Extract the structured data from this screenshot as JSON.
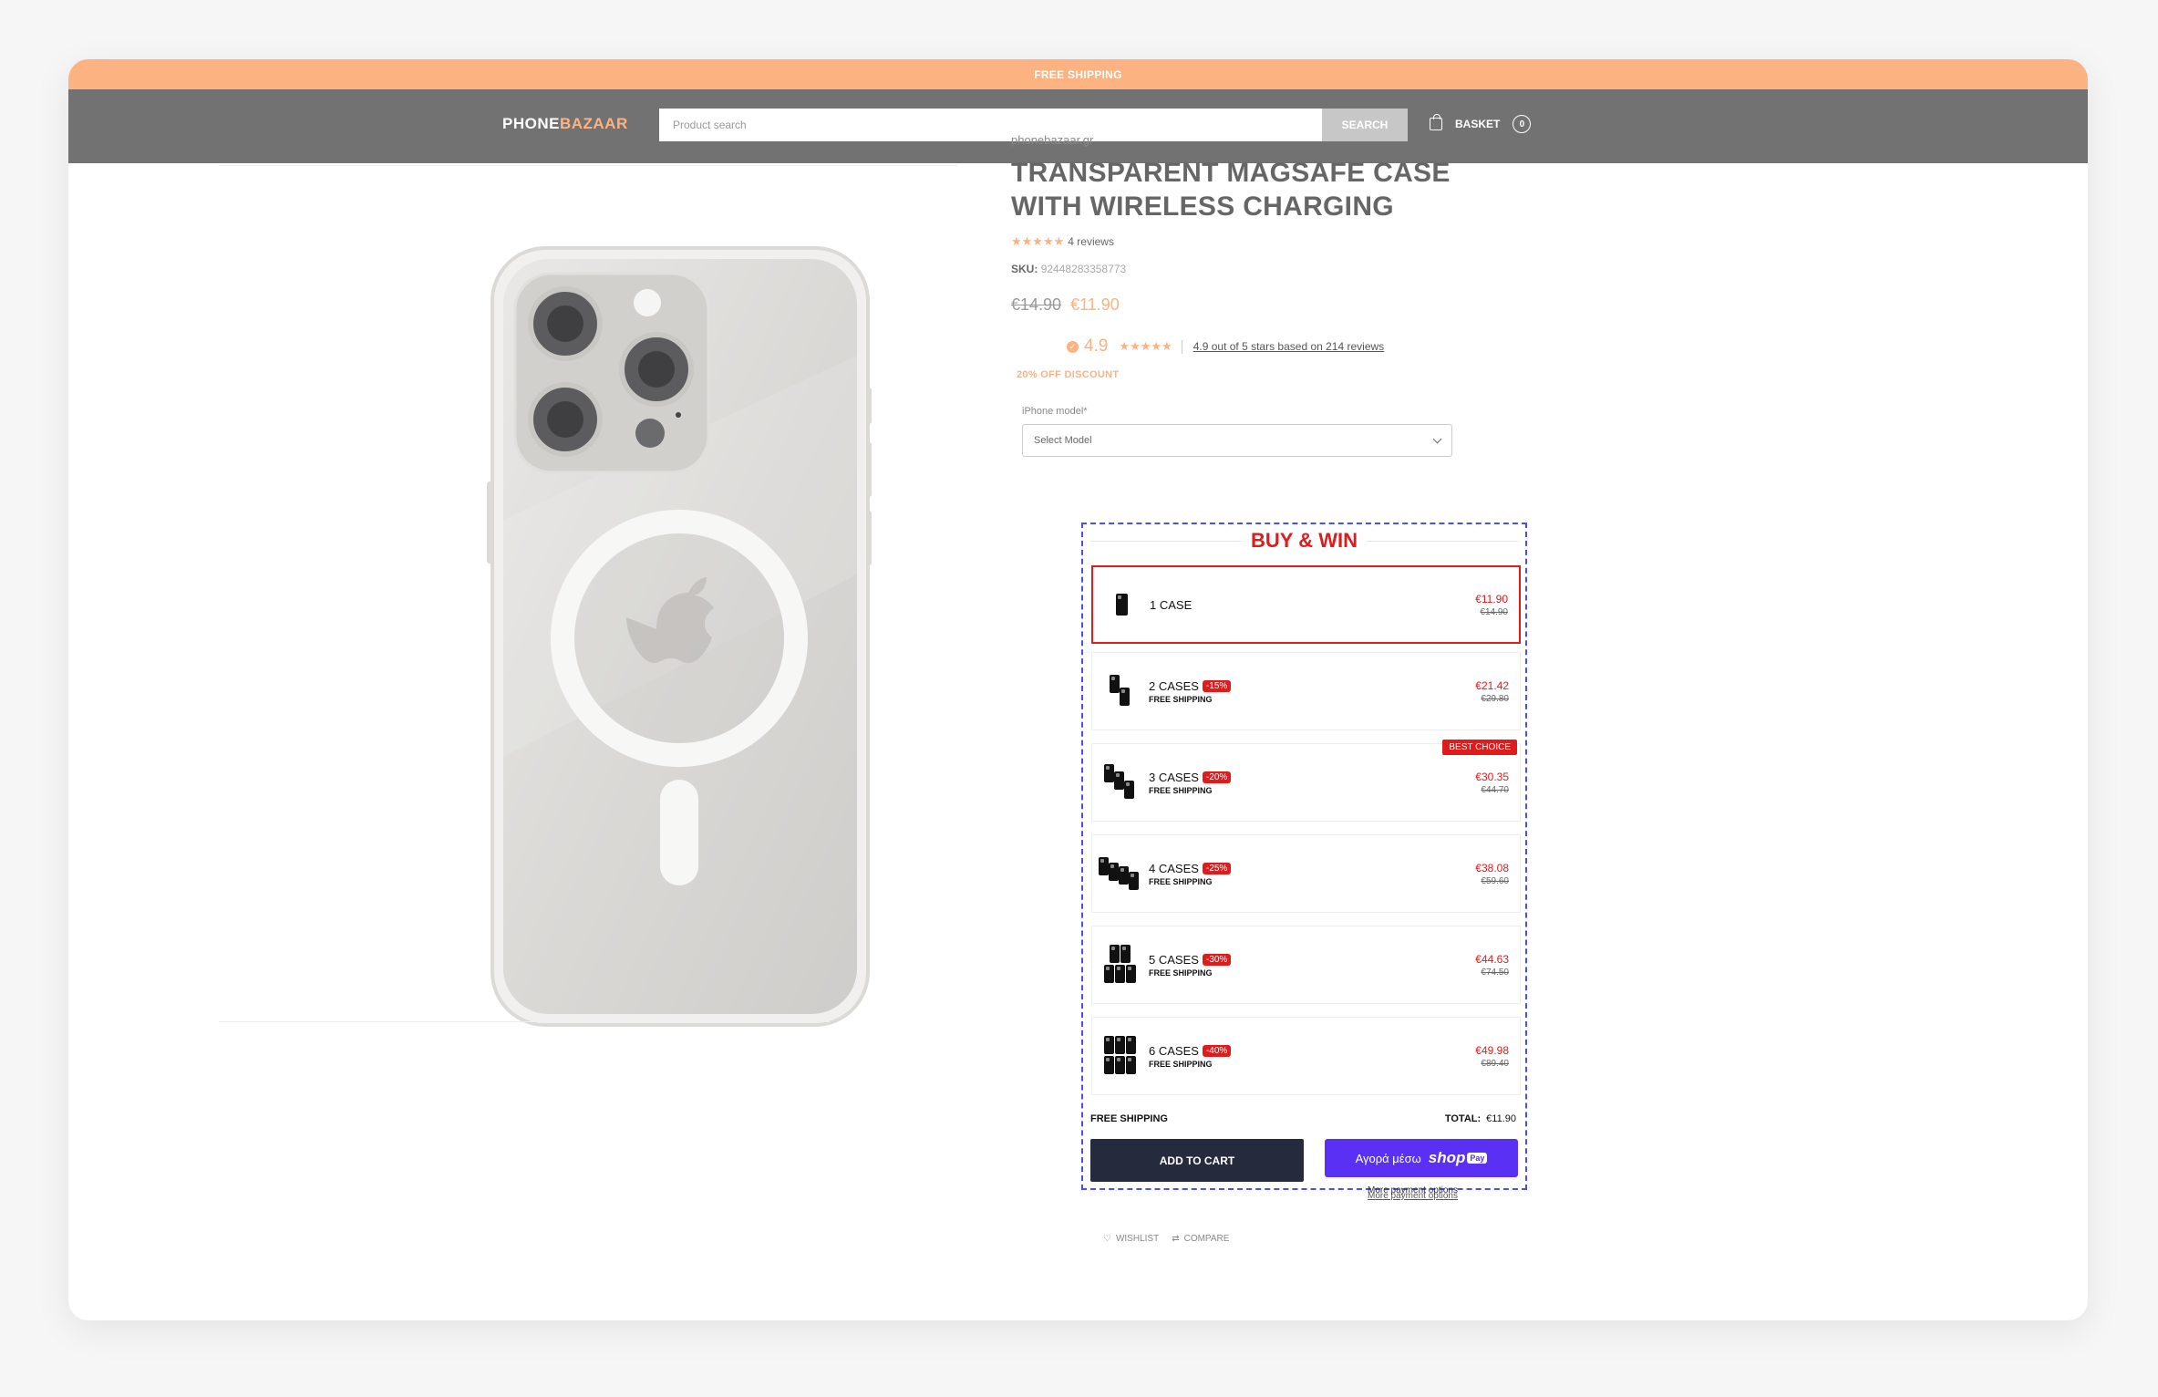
{
  "topbar": {
    "text": "FREE SHIPPING"
  },
  "header": {
    "logo_part1": "PHONE",
    "logo_part2": "BAZAAR",
    "search_placeholder": "Product search",
    "search_button": "SEARCH",
    "basket_label": "BASKET",
    "basket_count": "0"
  },
  "product": {
    "brand": "phonebazaar.gr",
    "title_line1": "TRANSPARENT MAGSAFE CASE",
    "title_line2": "WITH WIRELESS CHARGING",
    "stars": "★★★★★",
    "reviews": "4 reviews",
    "sku_label": "SKU:",
    "sku_value": "92448283358773",
    "old_price": "€14.90",
    "new_price": "€11.90",
    "rating_score": "4.9",
    "rating_text": "4.9 out of 5 stars based on 214 reviews",
    "discount": "20% OFF DISCOUNT",
    "model_label": "iPhone model*",
    "model_select": "Select Model"
  },
  "bundle": {
    "title": "BUY & WIN",
    "best_choice": "BEST CHOICE",
    "options": [
      {
        "name": "1 CASE",
        "badge": "",
        "shipping": "",
        "price": "€11.90",
        "old": "€14.90",
        "icon": "phone-case-icon"
      },
      {
        "name": "2 CASES",
        "badge": "-15%",
        "shipping": "FREE SHIPPING",
        "price": "€21.42",
        "old": "€29.80",
        "icon": "phone-case-icon"
      },
      {
        "name": "3 CASES",
        "badge": "-20%",
        "shipping": "FREE SHIPPING",
        "price": "€30.35",
        "old": "€44.70",
        "icon": "phone-case-icon"
      },
      {
        "name": "4 CASES",
        "badge": "-25%",
        "shipping": "FREE SHIPPING",
        "price": "€38.08",
        "old": "€59.60",
        "icon": "phone-case-icon"
      },
      {
        "name": "5 CASES",
        "badge": "-30%",
        "shipping": "FREE SHIPPING",
        "price": "€44.63",
        "old": "€74.50",
        "icon": "phone-case-icon"
      },
      {
        "name": "6 CASES",
        "badge": "-40%",
        "shipping": "FREE SHIPPING",
        "price": "€49.98",
        "old": "€89.40",
        "icon": "phone-case-icon"
      }
    ],
    "free_shipping": "FREE SHIPPING",
    "total_label": "TOTAL:",
    "total_value": "€11.90",
    "add_to_cart": "ADD TO CART",
    "shoppay_text": "Αγορά μέσω",
    "shoppay_brand": "shop",
    "shoppay_pay": "Pay",
    "more_options": "More payment options"
  },
  "actions": {
    "wishlist": "WISHLIST",
    "compare": "COMPARE"
  },
  "colors": {
    "accent": "#fdb282",
    "header": "#727272",
    "red": "#e01b1b",
    "dashed": "#4a4ff0",
    "shoppay": "#5a31f4",
    "cart": "#262a3d"
  }
}
